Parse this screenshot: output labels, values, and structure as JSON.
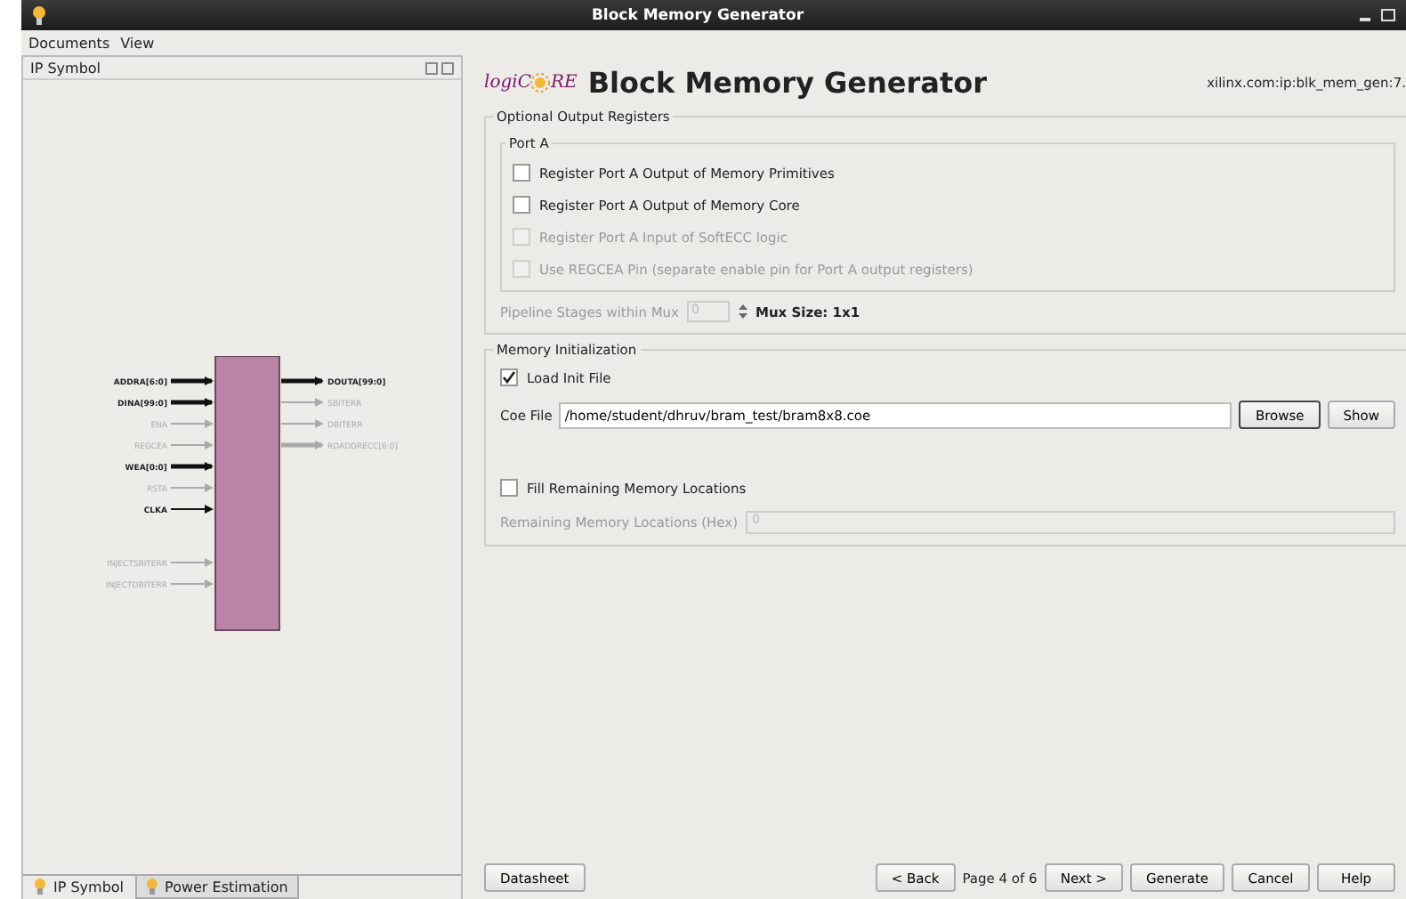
{
  "window": {
    "title": "Block Memory Generator"
  },
  "menu": [
    "Documents",
    "View"
  ],
  "left_panel": {
    "title": "IP Symbol",
    "symbol": {
      "left_pins": [
        {
          "label": "ADDRA[6:0]",
          "bus": true,
          "enabled": true
        },
        {
          "label": "DINA[99:0]",
          "bus": true,
          "enabled": true
        },
        {
          "label": "ENA",
          "bus": false,
          "enabled": false
        },
        {
          "label": "REGCEA",
          "bus": false,
          "enabled": false
        },
        {
          "label": "WEA[0:0]",
          "bus": true,
          "enabled": true
        },
        {
          "label": "RSTA",
          "bus": false,
          "enabled": false
        },
        {
          "label": "CLKA",
          "bus": false,
          "enabled": true
        },
        {
          "label": "INJECTSBITERR",
          "bus": false,
          "enabled": false
        },
        {
          "label": "INJECTDBITERR",
          "bus": false,
          "enabled": false
        }
      ],
      "right_pins": [
        {
          "label": "DOUTA[99:0]",
          "bus": true,
          "enabled": true
        },
        {
          "label": "SBITERR",
          "bus": false,
          "enabled": false
        },
        {
          "label": "DBITERR",
          "bus": false,
          "enabled": false
        },
        {
          "label": "RDADDRECC[6:0]",
          "bus": true,
          "enabled": false
        }
      ]
    },
    "tabs": [
      {
        "label": "IP Symbol",
        "selected": true
      },
      {
        "label": "Power Estimation",
        "selected": false
      }
    ]
  },
  "header": {
    "logo_prefix": "logiC",
    "logo_suffix": "RE",
    "title": "Block Memory Generator",
    "ip_name": "xilinx.com:ip:blk_mem_gen:7."
  },
  "output_registers": {
    "title": "Optional Output Registers",
    "port_title": "Port A",
    "options": [
      {
        "label": "Register Port A Output of Memory Primitives",
        "checked": false,
        "disabled": false
      },
      {
        "label": "Register Port A Output of Memory Core",
        "checked": false,
        "disabled": false
      },
      {
        "label": "Register Port A Input of SoftECC logic",
        "checked": false,
        "disabled": true
      },
      {
        "label": "Use REGCEA Pin (separate enable pin for Port A output registers)",
        "checked": false,
        "disabled": true
      }
    ],
    "pipeline_label": "Pipeline Stages within Mux",
    "pipeline_value": "0",
    "mux_size": "Mux Size: 1x1"
  },
  "memory_init": {
    "title": "Memory Initialization",
    "load_init": {
      "label": "Load Init File",
      "checked": true
    },
    "coe_label": "Coe File",
    "coe_value": "/home/student/dhruv/bram_test/bram8x8.coe",
    "buttons": [
      "Browse",
      "Show"
    ],
    "fill_remaining": {
      "label": "Fill Remaining Memory Locations",
      "checked": false
    },
    "remaining_label": "Remaining Memory Locations (Hex)",
    "remaining_value": "0"
  },
  "footer": {
    "datasheet": "Datasheet",
    "back": "< Back",
    "page": "Page 4 of 6",
    "next": "Next >",
    "buttons": [
      "Generate",
      "Cancel",
      "Help"
    ]
  }
}
